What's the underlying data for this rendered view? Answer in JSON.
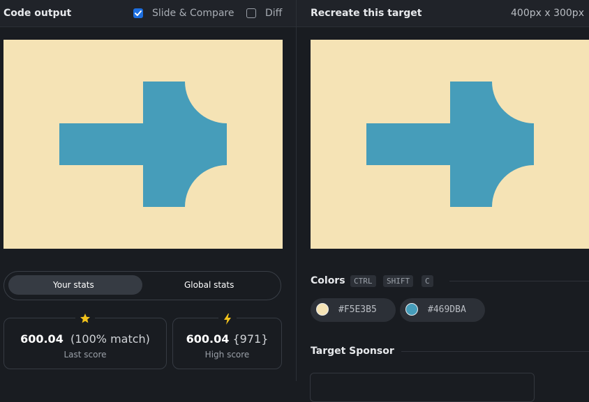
{
  "left_header": {
    "title": "Code output",
    "slide_compare": {
      "label": "Slide & Compare",
      "checked": true
    },
    "diff": {
      "label": "Diff",
      "checked": false
    }
  },
  "right_header": {
    "title": "Recreate this target",
    "dimensions": "400px x 300px"
  },
  "canvas": {
    "background_color": "#F5E3B5",
    "shape_color": "#469DBA",
    "shape": "arrow-right-icon"
  },
  "stats_toggle": {
    "your_stats": "Your stats",
    "global_stats": "Global stats",
    "active": "Your stats"
  },
  "last_score": {
    "icon": "star-icon",
    "value": "600.04",
    "detail": "(100% match)",
    "label": "Last score"
  },
  "high_score": {
    "icon": "lightning-icon",
    "value": "600.04",
    "detail": "{971}",
    "label": "High score"
  },
  "colors_section": {
    "title": "Colors",
    "shortcut": [
      "CTRL",
      "SHIFT",
      "C"
    ],
    "swatches": [
      {
        "hex": "#F5E3B5"
      },
      {
        "hex": "#469DBA"
      }
    ]
  },
  "sponsor_section": {
    "title": "Target Sponsor"
  }
}
